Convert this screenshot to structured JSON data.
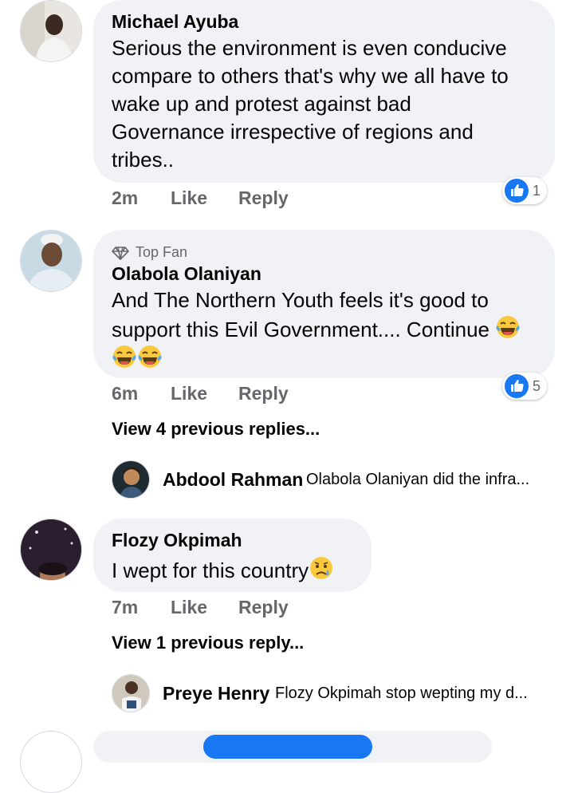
{
  "comments": [
    {
      "author": "Michael Ayuba",
      "lines": [
        "Serious the environment is even conducive",
        "compare to others that's why we all have to",
        "wake up and protest against bad",
        "Governance irrespective of regions and",
        "tribes.."
      ],
      "time": "2m",
      "like": "Like",
      "reply": "Reply",
      "reaction_count": "1"
    },
    {
      "badge": "Top Fan",
      "author": "Olabola Olaniyan",
      "lines": [
        "And The Northern Youth feels it's good to",
        "support this Evil Government.... Continue"
      ],
      "emoji": "laughing-tears",
      "time": "6m",
      "like": "Like",
      "reply": "Reply",
      "reaction_count": "5",
      "view_more": "View 4 previous replies...",
      "latest_reply": {
        "author": "Abdool Rahman",
        "text": "Olabola Olaniyan did the infra..."
      }
    },
    {
      "author": "Flozy Okpimah",
      "text": "I wept for this country",
      "emoji": "sad-tear",
      "time": "7m",
      "like": "Like",
      "reply": "Reply",
      "view_more": "View 1 previous reply...",
      "latest_reply": {
        "author": "Preye Henry",
        "text": "Flozy Okpimah stop wepting my d..."
      }
    }
  ],
  "colors": {
    "bubble": "#f0f2f5",
    "meta": "#65676b",
    "like_blue": "#1877f2",
    "text": "#050505"
  }
}
